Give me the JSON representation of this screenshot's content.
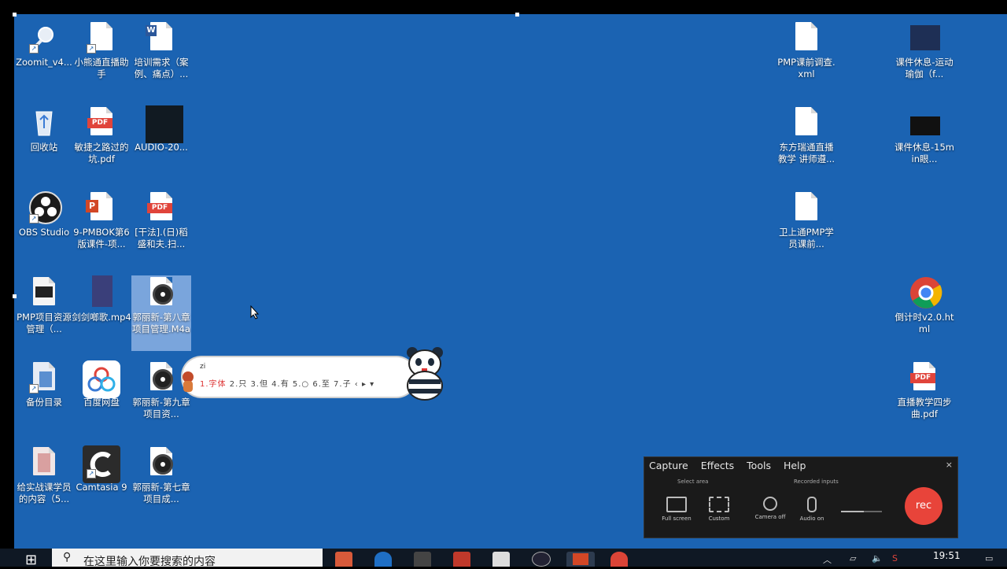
{
  "desktop": {
    "icons": [
      {
        "label": "Zoomit_v4..."
      },
      {
        "label": "小熊通直播助手"
      },
      {
        "label": "培训需求（案例、痛点）..."
      },
      {
        "label": "回收站"
      },
      {
        "label": "敏捷之路过的坑.pdf"
      },
      {
        "label": "AUDIO-20..."
      },
      {
        "label": "OBS Studio"
      },
      {
        "label": "9-PMBOK第6版课件-项..."
      },
      {
        "label": "[干法].(日)稻盛和夫.扫..."
      },
      {
        "label": "PMP项目资源管理（..."
      },
      {
        "label": "剑剑啷歌.mp4"
      },
      {
        "label": "郭丽新-第八章 项目管理.M4a"
      },
      {
        "label": "备份目录"
      },
      {
        "label": "百度网盘"
      },
      {
        "label": "郭丽新-第九章 项目资..."
      },
      {
        "label": "给实战课学员的内容（5..."
      },
      {
        "label": "Camtasia 9"
      },
      {
        "label": "郭丽新-第七章 项目成..."
      },
      {
        "label": "PMP课前调查.xml"
      },
      {
        "label": "东方瑞通直播教学 讲师遵..."
      },
      {
        "label": "卫上通PMP学员课前..."
      },
      {
        "label": "课件休息-运动瑜伽（f..."
      },
      {
        "label": "课件休息-15min眼..."
      },
      {
        "label": "倒计时v2.0.html"
      },
      {
        "label": "直播教学四步曲.pdf"
      }
    ]
  },
  "pet": {
    "line1": "zi",
    "line2_first": "1.字体",
    "line2_rest": " 2.只  3.但  4.有  5.○  6.至  7.子 ‹ ▸ ▾"
  },
  "recorder": {
    "menu": [
      "Capture",
      "Effects",
      "Tools",
      "Help"
    ],
    "close": "×",
    "select_area": "Select area",
    "recorded_inputs": "Recorded inputs",
    "buttons": [
      "Full screen",
      "Custom",
      "Camera off",
      "Audio on"
    ],
    "rec": "rec",
    "audio_level": 0.55
  },
  "taskbar": {
    "search_placeholder": "在这里输入你要搜索的内容",
    "time": "19:51",
    "apps": [
      "folder-app",
      "edge-app",
      "camtasia-app",
      "camtasia-recorder-app",
      "pet-app",
      "clock-app",
      "powerpoint-app",
      "chrome-app"
    ]
  },
  "colors": {
    "desktop": "#1b63b2",
    "rec_button": "#e8443a",
    "pdf_badge": "#e0443b"
  }
}
